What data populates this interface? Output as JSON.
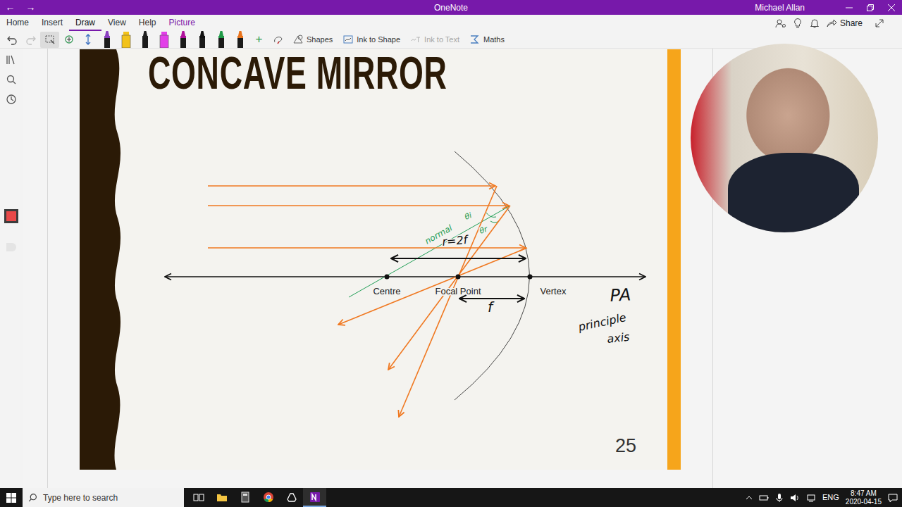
{
  "window": {
    "back": "←",
    "forward": "→",
    "title": "OneNote",
    "user": "Michael Allan",
    "share": "Share"
  },
  "ribbon_tabs": [
    {
      "label": "Home",
      "selected": false,
      "contextual": false
    },
    {
      "label": "Insert",
      "selected": false,
      "contextual": false
    },
    {
      "label": "Draw",
      "selected": true,
      "contextual": false
    },
    {
      "label": "View",
      "selected": false,
      "contextual": false
    },
    {
      "label": "Help",
      "selected": false,
      "contextual": false
    },
    {
      "label": "Picture",
      "selected": false,
      "contextual": true
    }
  ],
  "toolbar": {
    "tools": [
      {
        "kind": "undo",
        "selected": false,
        "disabled": false
      },
      {
        "kind": "redo",
        "selected": false,
        "disabled": true
      },
      {
        "kind": "lasso",
        "selected": true,
        "disabled": false
      },
      {
        "kind": "space",
        "selected": false,
        "disabled": false
      },
      {
        "kind": "move",
        "selected": false,
        "disabled": false
      }
    ],
    "pens": [
      {
        "kind": "pen",
        "color": "#8a3fc0"
      },
      {
        "kind": "highlighter",
        "color": "#f2c21b"
      },
      {
        "kind": "pen",
        "color": "#1e1e1e"
      },
      {
        "kind": "highlighter",
        "color": "#e23fe8"
      },
      {
        "kind": "pen",
        "color": "#b0109c"
      },
      {
        "kind": "pen",
        "color": "#111111"
      },
      {
        "kind": "pen",
        "color": "#1f9a48"
      },
      {
        "kind": "pen",
        "color": "#e8731c"
      }
    ],
    "add_pen": "+",
    "commands": [
      {
        "label": "Shapes",
        "disabled": false
      },
      {
        "label": "Ink to Shape",
        "disabled": false
      },
      {
        "label": "Ink to Text",
        "disabled": true
      },
      {
        "label": "Maths",
        "disabled": false
      }
    ]
  },
  "slide": {
    "title": "CONCAVE MIRROR",
    "page_number": "25",
    "points": [
      {
        "label": "Centre"
      },
      {
        "label": "Focal Point"
      },
      {
        "label": "Vertex"
      }
    ]
  },
  "ink": [
    {
      "text": "normal",
      "color": "#1f9d55"
    },
    {
      "text": "θi",
      "color": "#1f9d55"
    },
    {
      "text": "θr",
      "color": "#1f9d55"
    },
    {
      "text": "r=2f",
      "color": "#111111"
    },
    {
      "text": "f",
      "color": "#111111"
    },
    {
      "text": "PA",
      "color": "#111111"
    },
    {
      "text": "principle",
      "color": "#111111"
    },
    {
      "text": "axis",
      "color": "#111111"
    }
  ],
  "taskbar": {
    "search_placeholder": "Type here to search",
    "apps": [
      {
        "kind": "task-view",
        "active": false
      },
      {
        "kind": "file-explorer",
        "active": false
      },
      {
        "kind": "calculator",
        "active": false
      },
      {
        "kind": "chrome",
        "active": false
      },
      {
        "kind": "drive",
        "active": false
      },
      {
        "kind": "onenote",
        "active": true
      }
    ],
    "language": "ENG",
    "time": "8:47 AM",
    "date": "2020-04-15"
  }
}
